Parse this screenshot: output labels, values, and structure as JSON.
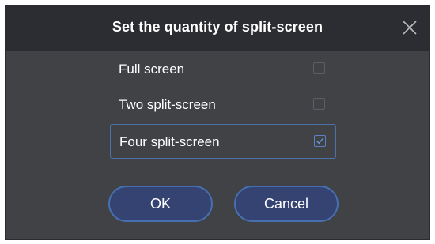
{
  "dialog": {
    "title": "Set the quantity of split-screen",
    "close_icon": "close-icon"
  },
  "options": [
    {
      "label": "Full screen",
      "checked": false
    },
    {
      "label": "Two split-screen",
      "checked": false
    },
    {
      "label": "Four split-screen",
      "checked": true
    }
  ],
  "buttons": {
    "ok_label": "OK",
    "cancel_label": "Cancel"
  },
  "colors": {
    "header_bg": "#2c2d32",
    "dialog_bg": "#404246",
    "accent": "#476fb0",
    "button_fill": "#354372"
  }
}
